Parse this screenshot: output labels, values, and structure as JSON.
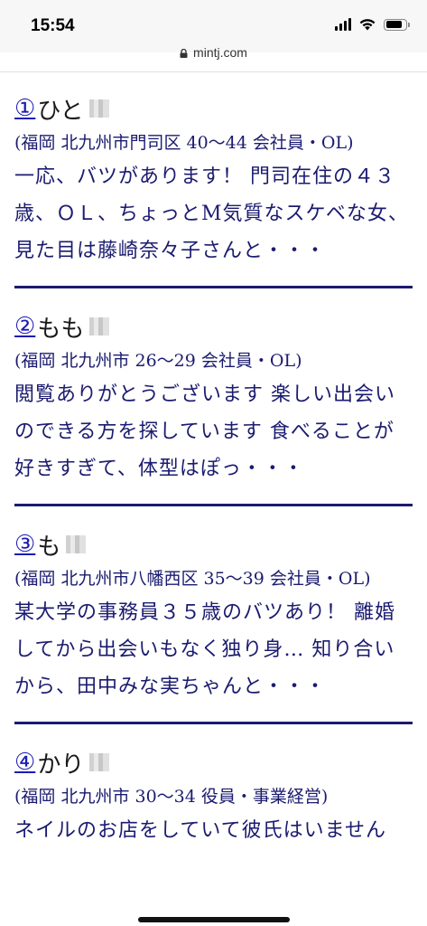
{
  "status_bar": {
    "time": "15:54",
    "battery_level": 0.85
  },
  "browser": {
    "url": "mintj.com"
  },
  "entries": [
    {
      "num": "①",
      "name": "ひと",
      "meta": "(福岡 北九州市門司区 40〜44 会社員・OL)",
      "body": "一応、バツがあります！ 門司在住の４３歳、ＯＬ、ちょっとM気質なスケベな女、見た目は藤崎奈々子さんと・・・"
    },
    {
      "num": "②",
      "name": "もも",
      "meta": "(福岡 北九州市 26〜29 会社員・OL)",
      "body": "閲覧ありがとうございます 楽しい出会いのできる方を探しています 食べることが好きすぎて、体型はぽっ・・・"
    },
    {
      "num": "③",
      "name": "も",
      "meta": "(福岡 北九州市八幡西区 35〜39 会社員・OL)",
      "body": "某大学の事務員３５歳のバツあり！ 離婚してから出会いもなく独り身… 知り合いから、田中みな実ちゃんと・・・"
    },
    {
      "num": "④",
      "name": "かり",
      "meta": "(福岡 北九州市 30〜34 役員・事業経営)",
      "body": "ネイルのお店をしていて彼氏はいません"
    }
  ]
}
